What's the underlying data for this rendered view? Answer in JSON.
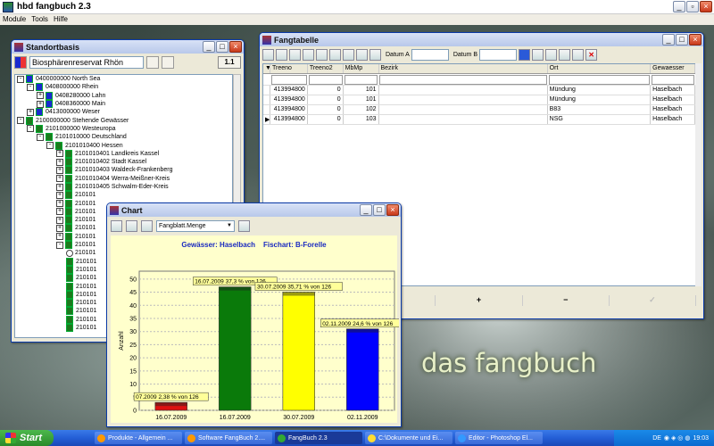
{
  "app": {
    "title": "hbd fangbuch 2.3",
    "menu": [
      "Module",
      "Tools",
      "Hilfe"
    ]
  },
  "standort": {
    "title": "Standortbasis",
    "selected": "Biosphärenreservat Rhön",
    "version_btn": "1.1",
    "tree": [
      {
        "indent": 0,
        "exp": "-",
        "icon": "blue",
        "label": "0400000000  North Sea"
      },
      {
        "indent": 1,
        "exp": "-",
        "icon": "blue",
        "label": "0408000000  Rhein"
      },
      {
        "indent": 2,
        "exp": "+",
        "icon": "blue",
        "label": "0408280000  Lahn"
      },
      {
        "indent": 2,
        "exp": "+",
        "icon": "blue",
        "label": "0408360000  Main"
      },
      {
        "indent": 1,
        "exp": "+",
        "icon": "blue",
        "label": "0413000000  Weser"
      },
      {
        "indent": 0,
        "exp": "-",
        "icon": "green",
        "label": "2100000000  Stehende Gewässer"
      },
      {
        "indent": 1,
        "exp": "-",
        "icon": "green",
        "label": "2101000000  Westeuropa"
      },
      {
        "indent": 2,
        "exp": "-",
        "icon": "green",
        "label": "2101010000  Deutschland"
      },
      {
        "indent": 3,
        "exp": "-",
        "icon": "green",
        "label": "2101010400  Hessen"
      },
      {
        "indent": 4,
        "exp": "+",
        "icon": "green",
        "label": "2101010401  Landkreis Kassel"
      },
      {
        "indent": 4,
        "exp": "+",
        "icon": "green",
        "label": "2101010402  Stadt Kassel"
      },
      {
        "indent": 4,
        "exp": "+",
        "icon": "green",
        "label": "2101010403  Waldeck-Frankenberg"
      },
      {
        "indent": 4,
        "exp": "+",
        "icon": "green",
        "label": "2101010404  Werra-Meißner-Kreis"
      },
      {
        "indent": 4,
        "exp": "+",
        "icon": "green",
        "label": "2101010405  Schwalm-Eder-Kreis"
      },
      {
        "indent": 4,
        "exp": "+",
        "icon": "green",
        "label": "210101"
      },
      {
        "indent": 4,
        "exp": "+",
        "icon": "green",
        "label": "210101"
      },
      {
        "indent": 4,
        "exp": "+",
        "icon": "green",
        "label": "210101"
      },
      {
        "indent": 4,
        "exp": "+",
        "icon": "green",
        "label": "210101"
      },
      {
        "indent": 4,
        "exp": "+",
        "icon": "green",
        "label": "210101"
      },
      {
        "indent": 4,
        "exp": "+",
        "icon": "green",
        "label": "210101"
      },
      {
        "indent": 4,
        "exp": "-",
        "icon": "green",
        "label": "210101"
      },
      {
        "indent": 5,
        "exp": "o",
        "icon": "none",
        "label": "210101"
      },
      {
        "indent": 5,
        "exp": "",
        "icon": "green",
        "label": "210101"
      },
      {
        "indent": 5,
        "exp": "",
        "icon": "green",
        "label": "210101"
      },
      {
        "indent": 5,
        "exp": "",
        "icon": "green",
        "label": "210101"
      },
      {
        "indent": 5,
        "exp": "",
        "icon": "green",
        "label": "210101"
      },
      {
        "indent": 5,
        "exp": "",
        "icon": "green",
        "label": "210101"
      },
      {
        "indent": 5,
        "exp": "",
        "icon": "green",
        "label": "210101"
      },
      {
        "indent": 5,
        "exp": "",
        "icon": "green",
        "label": "210101"
      },
      {
        "indent": 5,
        "exp": "",
        "icon": "green",
        "label": "210101"
      },
      {
        "indent": 5,
        "exp": "",
        "icon": "green",
        "label": "210101"
      }
    ]
  },
  "fang": {
    "title": "Fangtabelle",
    "datum_a": "Datum A",
    "datum_b": "Datum B",
    "columns": [
      "Treeno",
      "Treeno2",
      "MbMp",
      "Bezirk",
      "Ort",
      "Gewaesser"
    ],
    "rows": [
      [
        "413994800",
        "0",
        "101",
        "",
        "Mündung",
        "Haselbach"
      ],
      [
        "413994800",
        "0",
        "101",
        "",
        "Mündung",
        "Haselbach"
      ],
      [
        "413994800",
        "0",
        "102",
        "",
        "B83",
        "Haselbach"
      ],
      [
        "413994800",
        "0",
        "103",
        "",
        "NSG",
        "Haselbach"
      ]
    ],
    "nav": [
      "►",
      "►|",
      "+",
      "−",
      "✓"
    ]
  },
  "chart": {
    "title": "Chart",
    "select_value": "Fangblatt.Menge",
    "header_left": "Gewässer: Haselbach",
    "header_right": "Fischart: B-Forelle",
    "ylabel": "Anzahl"
  },
  "chart_data": {
    "type": "bar",
    "categories": [
      "16.07.2009",
      "16.07.2009",
      "30.07.2009",
      "02.11.2009"
    ],
    "values": [
      3,
      47,
      45,
      31
    ],
    "colors": [
      "#dd1111",
      "#0a7a0a",
      "#ffff00",
      "#0000ff"
    ],
    "data_labels": [
      "07.2009 2,38 % von 126",
      "16.07.2009 37,3 % von 126",
      "30.07.2009 35,71 % von 126",
      "02.11.2009 24,6 % von 126"
    ],
    "yticks": [
      0,
      5,
      10,
      15,
      20,
      25,
      30,
      35,
      40,
      45,
      50
    ],
    "ylim": [
      0,
      53
    ],
    "ylabel": "Anzahl",
    "grid": true
  },
  "watermark": "das fangbuch",
  "taskbar": {
    "start": "Start",
    "tasks": [
      "Produkte - Allgemein ...",
      "Software FangBuch 2....",
      "FangBuch 2.3",
      "C:\\Dokumente und Ei...",
      "Editor - Photoshop El..."
    ],
    "lang": "DE",
    "time": "19:03"
  }
}
